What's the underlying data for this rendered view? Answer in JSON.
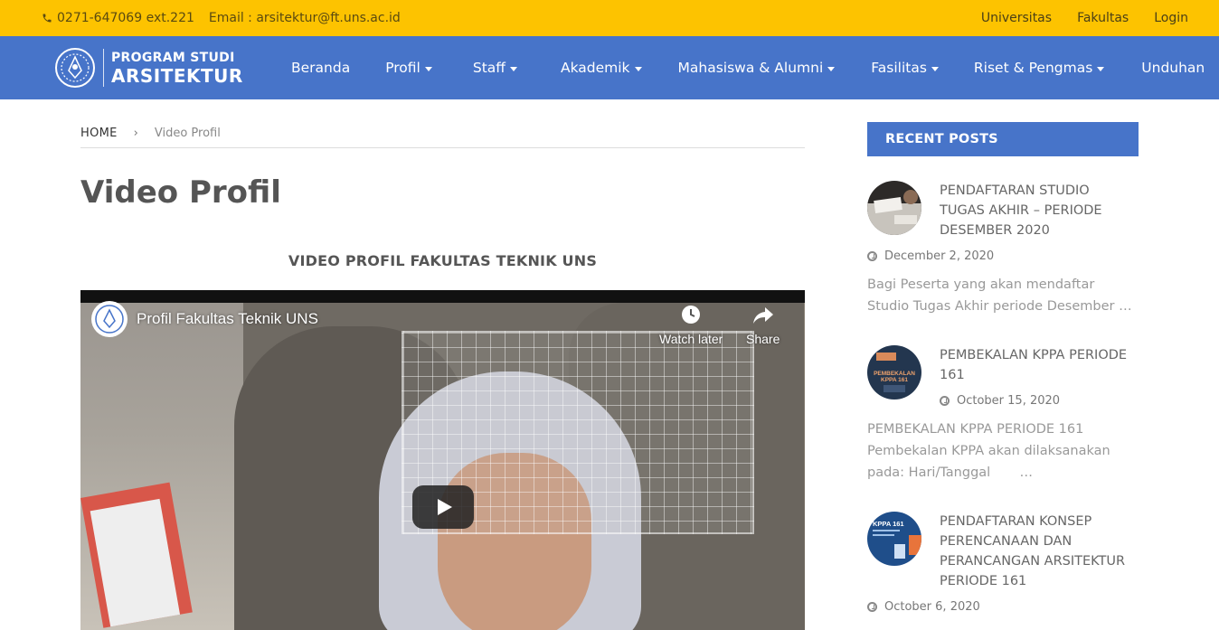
{
  "topbar": {
    "phone_icon": "phone-icon",
    "phone": "0271-647069 ext.221",
    "email": "Email : arsitektur@ft.uns.ac.id",
    "links": [
      "Universitas",
      "Fakultas",
      "Login"
    ]
  },
  "brand": {
    "line1": "PROGRAM STUDI",
    "line2": "ARSITEKTUR"
  },
  "nav": {
    "items": [
      {
        "label": "Beranda"
      },
      {
        "label": "Profil"
      },
      {
        "label": "Staff"
      },
      {
        "label": "Akademik"
      },
      {
        "label": "Mahasiswa & Alumni"
      },
      {
        "label": "Fasilitas"
      },
      {
        "label": "Riset & Pengmas"
      },
      {
        "label": "Unduhan"
      }
    ]
  },
  "breadcrumb": {
    "home": "HOME",
    "separator": "›",
    "current": "Video Profil"
  },
  "main": {
    "title": "Video Profil",
    "video_heading": "VIDEO PROFIL FAKULTAS TEKNIK UNS"
  },
  "video": {
    "title": "Profil Fakultas Teknik UNS",
    "watch_later": "Watch later",
    "share": "Share"
  },
  "sidebar": {
    "header": "RECENT POSTS",
    "posts": [
      {
        "title": "PENDAFTARAN STUDIO TUGAS AKHIR – PERIODE DESEMBER 2020",
        "date": "December 2, 2020",
        "excerpt": "Bagi Peserta yang akan mendaftar Studio Tugas Akhir periode Desember …"
      },
      {
        "title": "PEMBEKALAN KPPA PERIODE 161",
        "date": "October 15, 2020",
        "excerpt": "PEMBEKALAN KPPA PERIODE 161 Pembekalan KPPA akan dilaksanakan pada: Hari/Tanggal       …",
        "thumb_text_1": "PEMBEKALAN",
        "thumb_text_2": "KPPA 161"
      },
      {
        "title": "PENDAFTARAN KONSEP PERENCANAAN DAN PERANCANGAN ARSITEKTUR PERIODE 161",
        "date": "October 6, 2020",
        "thumb_text": "KPPA 161"
      }
    ]
  },
  "colors": {
    "topbar": "#fdc300",
    "navbar": "#4774c9",
    "sidebar_header": "#4774c9"
  }
}
